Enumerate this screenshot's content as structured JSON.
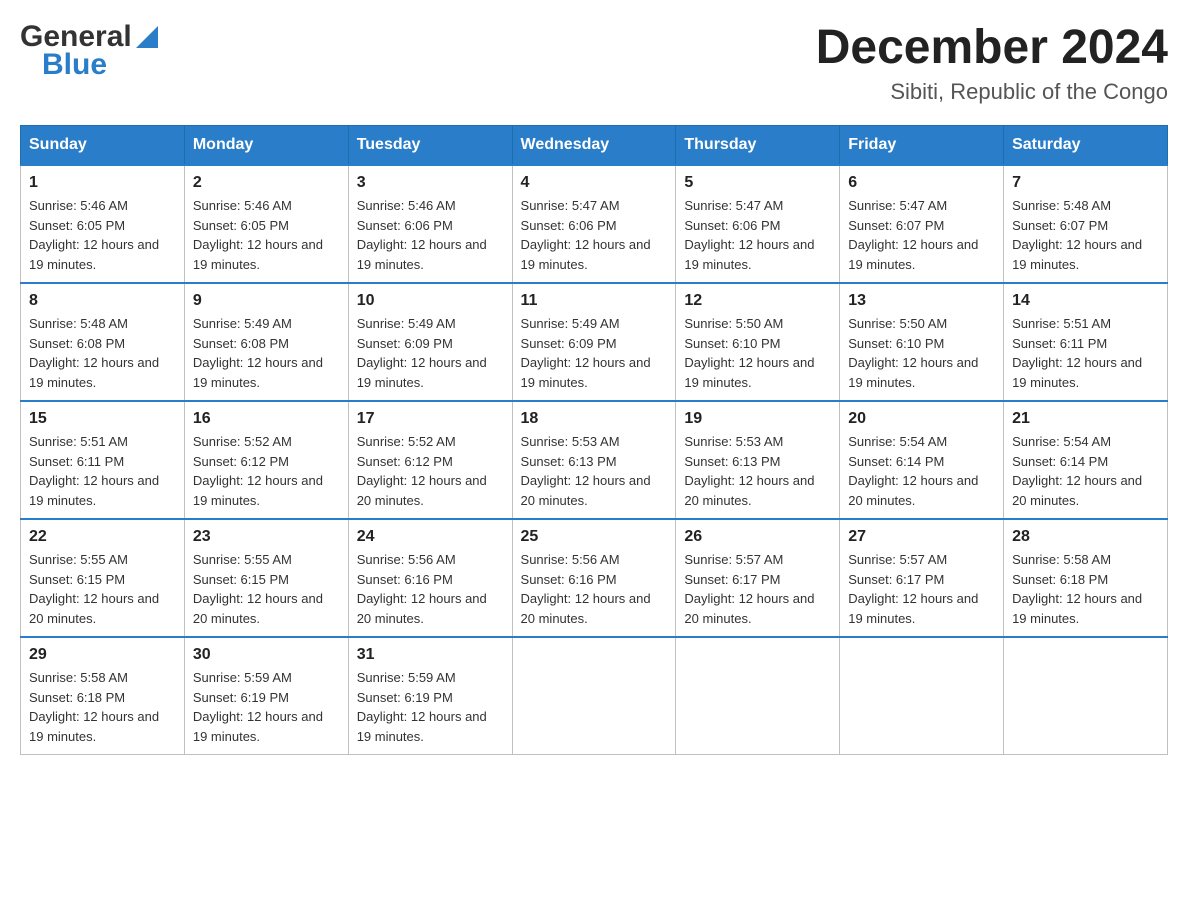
{
  "header": {
    "logo_general": "General",
    "logo_blue": "Blue",
    "month_title": "December 2024",
    "subtitle": "Sibiti, Republic of the Congo"
  },
  "days_of_week": [
    "Sunday",
    "Monday",
    "Tuesday",
    "Wednesday",
    "Thursday",
    "Friday",
    "Saturday"
  ],
  "weeks": [
    [
      {
        "day": "1",
        "sunrise": "5:46 AM",
        "sunset": "6:05 PM",
        "daylight": "12 hours and 19 minutes."
      },
      {
        "day": "2",
        "sunrise": "5:46 AM",
        "sunset": "6:05 PM",
        "daylight": "12 hours and 19 minutes."
      },
      {
        "day": "3",
        "sunrise": "5:46 AM",
        "sunset": "6:06 PM",
        "daylight": "12 hours and 19 minutes."
      },
      {
        "day": "4",
        "sunrise": "5:47 AM",
        "sunset": "6:06 PM",
        "daylight": "12 hours and 19 minutes."
      },
      {
        "day": "5",
        "sunrise": "5:47 AM",
        "sunset": "6:06 PM",
        "daylight": "12 hours and 19 minutes."
      },
      {
        "day": "6",
        "sunrise": "5:47 AM",
        "sunset": "6:07 PM",
        "daylight": "12 hours and 19 minutes."
      },
      {
        "day": "7",
        "sunrise": "5:48 AM",
        "sunset": "6:07 PM",
        "daylight": "12 hours and 19 minutes."
      }
    ],
    [
      {
        "day": "8",
        "sunrise": "5:48 AM",
        "sunset": "6:08 PM",
        "daylight": "12 hours and 19 minutes."
      },
      {
        "day": "9",
        "sunrise": "5:49 AM",
        "sunset": "6:08 PM",
        "daylight": "12 hours and 19 minutes."
      },
      {
        "day": "10",
        "sunrise": "5:49 AM",
        "sunset": "6:09 PM",
        "daylight": "12 hours and 19 minutes."
      },
      {
        "day": "11",
        "sunrise": "5:49 AM",
        "sunset": "6:09 PM",
        "daylight": "12 hours and 19 minutes."
      },
      {
        "day": "12",
        "sunrise": "5:50 AM",
        "sunset": "6:10 PM",
        "daylight": "12 hours and 19 minutes."
      },
      {
        "day": "13",
        "sunrise": "5:50 AM",
        "sunset": "6:10 PM",
        "daylight": "12 hours and 19 minutes."
      },
      {
        "day": "14",
        "sunrise": "5:51 AM",
        "sunset": "6:11 PM",
        "daylight": "12 hours and 19 minutes."
      }
    ],
    [
      {
        "day": "15",
        "sunrise": "5:51 AM",
        "sunset": "6:11 PM",
        "daylight": "12 hours and 19 minutes."
      },
      {
        "day": "16",
        "sunrise": "5:52 AM",
        "sunset": "6:12 PM",
        "daylight": "12 hours and 19 minutes."
      },
      {
        "day": "17",
        "sunrise": "5:52 AM",
        "sunset": "6:12 PM",
        "daylight": "12 hours and 20 minutes."
      },
      {
        "day": "18",
        "sunrise": "5:53 AM",
        "sunset": "6:13 PM",
        "daylight": "12 hours and 20 minutes."
      },
      {
        "day": "19",
        "sunrise": "5:53 AM",
        "sunset": "6:13 PM",
        "daylight": "12 hours and 20 minutes."
      },
      {
        "day": "20",
        "sunrise": "5:54 AM",
        "sunset": "6:14 PM",
        "daylight": "12 hours and 20 minutes."
      },
      {
        "day": "21",
        "sunrise": "5:54 AM",
        "sunset": "6:14 PM",
        "daylight": "12 hours and 20 minutes."
      }
    ],
    [
      {
        "day": "22",
        "sunrise": "5:55 AM",
        "sunset": "6:15 PM",
        "daylight": "12 hours and 20 minutes."
      },
      {
        "day": "23",
        "sunrise": "5:55 AM",
        "sunset": "6:15 PM",
        "daylight": "12 hours and 20 minutes."
      },
      {
        "day": "24",
        "sunrise": "5:56 AM",
        "sunset": "6:16 PM",
        "daylight": "12 hours and 20 minutes."
      },
      {
        "day": "25",
        "sunrise": "5:56 AM",
        "sunset": "6:16 PM",
        "daylight": "12 hours and 20 minutes."
      },
      {
        "day": "26",
        "sunrise": "5:57 AM",
        "sunset": "6:17 PM",
        "daylight": "12 hours and 20 minutes."
      },
      {
        "day": "27",
        "sunrise": "5:57 AM",
        "sunset": "6:17 PM",
        "daylight": "12 hours and 19 minutes."
      },
      {
        "day": "28",
        "sunrise": "5:58 AM",
        "sunset": "6:18 PM",
        "daylight": "12 hours and 19 minutes."
      }
    ],
    [
      {
        "day": "29",
        "sunrise": "5:58 AM",
        "sunset": "6:18 PM",
        "daylight": "12 hours and 19 minutes."
      },
      {
        "day": "30",
        "sunrise": "5:59 AM",
        "sunset": "6:19 PM",
        "daylight": "12 hours and 19 minutes."
      },
      {
        "day": "31",
        "sunrise": "5:59 AM",
        "sunset": "6:19 PM",
        "daylight": "12 hours and 19 minutes."
      },
      null,
      null,
      null,
      null
    ]
  ]
}
